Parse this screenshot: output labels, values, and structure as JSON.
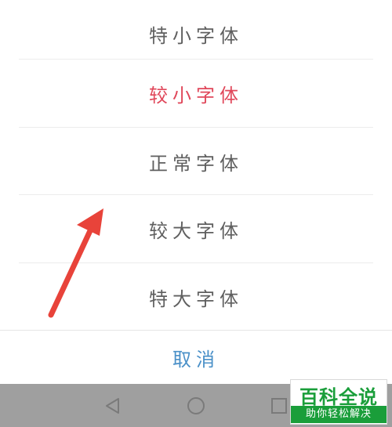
{
  "font_options": [
    {
      "label": "特小字体",
      "selected": false
    },
    {
      "label": "较小字体",
      "selected": true
    },
    {
      "label": "正常字体",
      "selected": false
    },
    {
      "label": "较大字体",
      "selected": false
    },
    {
      "label": "特大字体",
      "selected": false
    }
  ],
  "cancel": {
    "label": "取消",
    "color": "#4a90c8"
  },
  "colors": {
    "selected_text": "#e0475a",
    "normal_text": "#5f5f5f",
    "arrow": "#e8433a",
    "navbar": "#9f9f9f",
    "watermark_green": "#1a9e3a"
  },
  "navigation_bar": {
    "buttons": [
      "back-icon",
      "home-icon",
      "recents-icon"
    ]
  },
  "watermark": {
    "title": "百科全说",
    "subtitle": "助你轻松解决"
  }
}
